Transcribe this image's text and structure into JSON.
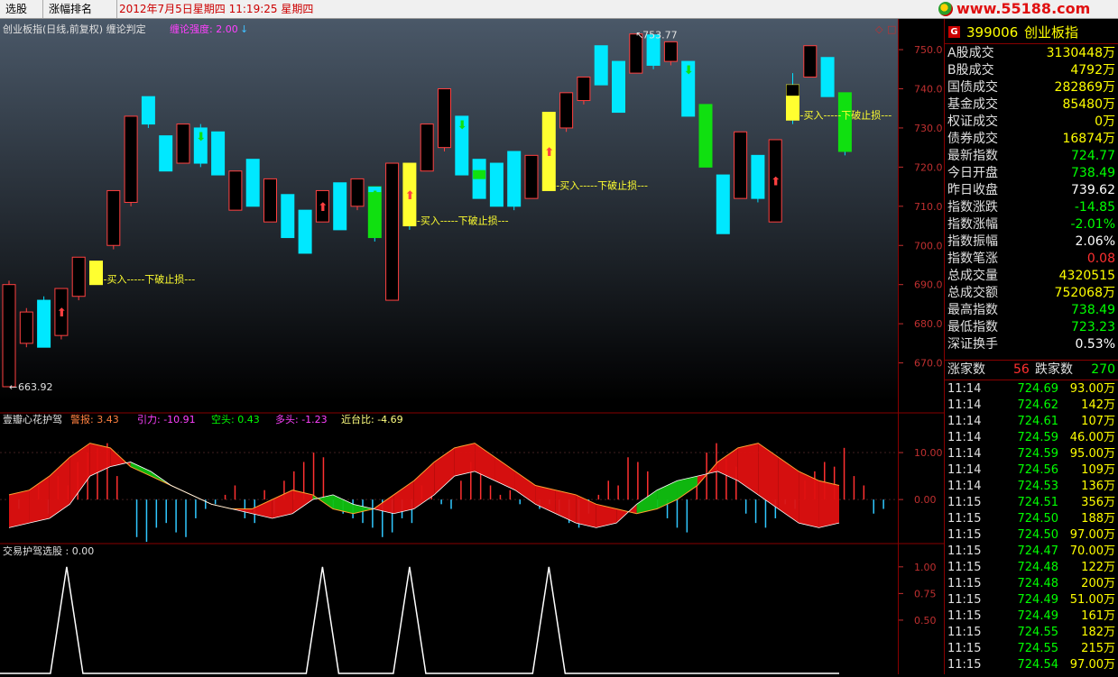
{
  "topbar": {
    "tabs": [
      "选股",
      "涨幅排名"
    ],
    "datetime": "2012年7月5日星期四  11:19:25 星期四",
    "logo": "www.55188.com"
  },
  "panels": {
    "main": {
      "title": "创业板指(日线,前复权) 缠论判定",
      "indicator": "缠论强度: 2.00",
      "high_label": "753.77",
      "low_label": "663.92",
      "buy_label": "--买入-----下破止损---",
      "y_ticks": [
        "750.0",
        "740.0",
        "730.0",
        "720.0",
        "710.0",
        "700.0",
        "690.0",
        "680.0",
        "670.0"
      ]
    },
    "middle": {
      "title": "壹瓣心花护驾",
      "warn": "警报: 3.43",
      "pull": "引力: -10.91",
      "short": "空头: 0.43",
      "long": "多头: -1.23",
      "near": "近台比: -4.69",
      "y_ticks": [
        "10.00",
        "0.00"
      ]
    },
    "bottom": {
      "title": "交易护驾选股 : 0.00",
      "y_ticks": [
        "1.00",
        "0.75",
        "0.50"
      ]
    }
  },
  "chart_data": {
    "type": "candlestick",
    "y_range": [
      660,
      756
    ],
    "candles": [
      {
        "o": 690,
        "c": 663.92,
        "h": 691,
        "l": 663.92,
        "style": "hollow"
      },
      {
        "o": 683,
        "c": 675,
        "h": 684,
        "l": 674,
        "style": "hollow"
      },
      {
        "o": 686,
        "c": 674,
        "h": 687,
        "l": 674,
        "style": "cyan"
      },
      {
        "o": 677,
        "c": 689,
        "h": 689,
        "l": 676,
        "style": "hollow",
        "mark": "up"
      },
      {
        "o": 687,
        "c": 697,
        "h": 697,
        "l": 686,
        "style": "hollow"
      },
      {
        "o": 690,
        "c": 696,
        "h": 696,
        "l": 690,
        "style": "yellow",
        "buy": true
      },
      {
        "o": 700,
        "c": 714,
        "h": 714,
        "l": 699,
        "style": "hollow"
      },
      {
        "o": 711,
        "c": 733,
        "h": 733,
        "l": 710,
        "style": "hollow"
      },
      {
        "o": 738,
        "c": 731,
        "h": 738,
        "l": 730,
        "style": "cyan"
      },
      {
        "o": 728,
        "c": 719,
        "h": 728,
        "l": 719,
        "style": "cyan"
      },
      {
        "o": 731,
        "c": 721,
        "h": 731,
        "l": 721,
        "style": "hollow"
      },
      {
        "o": 730,
        "c": 721,
        "h": 731,
        "l": 720,
        "style": "cyan",
        "mark": "down"
      },
      {
        "o": 729,
        "c": 718,
        "h": 729,
        "l": 718,
        "style": "cyan"
      },
      {
        "o": 719,
        "c": 709,
        "h": 719,
        "l": 709,
        "style": "hollow"
      },
      {
        "o": 722,
        "c": 710,
        "h": 722,
        "l": 710,
        "style": "cyan"
      },
      {
        "o": 717,
        "c": 706,
        "h": 717,
        "l": 706,
        "style": "hollow"
      },
      {
        "o": 713,
        "c": 702,
        "h": 713,
        "l": 702,
        "style": "cyan"
      },
      {
        "o": 709,
        "c": 698,
        "h": 709,
        "l": 698,
        "style": "cyan"
      },
      {
        "o": 706,
        "c": 714,
        "h": 714,
        "l": 706,
        "style": "hollow",
        "mark": "up"
      },
      {
        "o": 716,
        "c": 704,
        "h": 716,
        "l": 704,
        "style": "cyan"
      },
      {
        "o": 710,
        "c": 717,
        "h": 717,
        "l": 709,
        "style": "hollow"
      },
      {
        "o": 715,
        "c": 702,
        "h": 715,
        "l": 701,
        "style": "green",
        "cyantop": true,
        "mark": "down"
      },
      {
        "o": 686,
        "c": 721,
        "h": 721,
        "l": 686,
        "style": "hollow"
      },
      {
        "o": 705,
        "c": 721,
        "h": 721,
        "l": 704,
        "style": "yellow",
        "mark": "up",
        "buy": true
      },
      {
        "o": 719,
        "c": 731,
        "h": 731,
        "l": 719,
        "style": "hollow"
      },
      {
        "o": 740,
        "c": 725,
        "h": 740,
        "l": 724,
        "style": "hollow"
      },
      {
        "o": 733,
        "c": 718,
        "h": 733,
        "l": 718,
        "style": "cyan",
        "mark": "down"
      },
      {
        "o": 722,
        "c": 712,
        "h": 722,
        "l": 712,
        "style": "cyan",
        "greenmid": true
      },
      {
        "o": 721,
        "c": 710,
        "h": 721,
        "l": 710,
        "style": "cyan"
      },
      {
        "o": 724,
        "c": 710,
        "h": 724,
        "l": 709,
        "style": "cyan"
      },
      {
        "o": 723,
        "c": 712,
        "h": 723,
        "l": 712,
        "style": "hollow"
      },
      {
        "o": 714,
        "c": 734,
        "h": 734,
        "l": 714,
        "style": "yellow",
        "mark": "up",
        "buy": true
      },
      {
        "o": 730,
        "c": 739,
        "h": 739,
        "l": 729,
        "style": "hollow"
      },
      {
        "o": 743,
        "c": 737,
        "h": 743,
        "l": 736,
        "style": "hollow"
      },
      {
        "o": 751,
        "c": 741,
        "h": 751,
        "l": 741,
        "style": "cyan"
      },
      {
        "o": 747,
        "c": 734,
        "h": 747,
        "l": 734,
        "style": "cyan"
      },
      {
        "o": 744,
        "c": 754,
        "h": 754,
        "l": 744,
        "style": "hollow"
      },
      {
        "o": 753.77,
        "c": 746,
        "h": 753.77,
        "l": 745,
        "style": "cyan"
      },
      {
        "o": 747,
        "c": 752,
        "h": 752,
        "l": 746,
        "style": "hollow"
      },
      {
        "o": 747,
        "c": 733,
        "h": 747,
        "l": 733,
        "style": "cyan",
        "mark": "down"
      },
      {
        "o": 736,
        "c": 720,
        "h": 736,
        "l": 720,
        "style": "green"
      },
      {
        "o": 718,
        "c": 703,
        "h": 718,
        "l": 703,
        "style": "cyan"
      },
      {
        "o": 729,
        "c": 712,
        "h": 729,
        "l": 712,
        "style": "hollow"
      },
      {
        "o": 723,
        "c": 712,
        "h": 723,
        "l": 711,
        "style": "cyan"
      },
      {
        "o": 706,
        "c": 727,
        "h": 727,
        "l": 706,
        "style": "hollow",
        "mark": "up"
      },
      {
        "o": 732,
        "c": 741,
        "h": 744,
        "l": 731,
        "style": "yellow",
        "blacktop": true,
        "buy": true
      },
      {
        "o": 743,
        "c": 751,
        "h": 751,
        "l": 743,
        "style": "hollow"
      },
      {
        "o": 748,
        "c": 738,
        "h": 748,
        "l": 738,
        "style": "cyan"
      },
      {
        "o": 739,
        "c": 724,
        "h": 739,
        "l": 723,
        "style": "green",
        "mark": "down"
      }
    ],
    "oscillator_range": [
      -9,
      15
    ],
    "oscillator_bars": [
      0,
      -2,
      0,
      3,
      -3,
      5,
      3,
      8,
      10,
      11,
      12,
      5,
      0,
      -8,
      -9,
      -6,
      -5,
      -7,
      -8,
      -4,
      -2,
      -1,
      1,
      3,
      -4,
      -5,
      2,
      -3,
      4,
      6,
      8,
      10,
      9,
      -2,
      -3,
      -4,
      -5,
      -6,
      -8,
      -7,
      -4,
      -5,
      3,
      1,
      -1,
      -2,
      4,
      8,
      6,
      3,
      1,
      2,
      -1,
      0,
      -2,
      -1,
      -3,
      -5,
      -6,
      -3,
      1,
      4,
      3,
      9,
      8,
      6,
      -2,
      -4,
      -6,
      -7,
      5,
      10,
      12,
      9,
      7,
      -3,
      -5,
      -6,
      -4,
      -1,
      -2,
      4,
      6,
      8,
      7,
      11,
      5,
      3,
      -3,
      -2
    ],
    "osc_upper": [
      1,
      2,
      5,
      9,
      12,
      11,
      7,
      5,
      3,
      1,
      -1,
      -2,
      -2,
      0,
      2,
      1,
      -2,
      -3,
      -2,
      1,
      4,
      8,
      11,
      12,
      9,
      6,
      3,
      2,
      1,
      -1,
      -2,
      -3,
      -2,
      0,
      3,
      8,
      11,
      12,
      9,
      6,
      4,
      3
    ],
    "osc_lower": [
      -6,
      -5,
      -4,
      -1,
      5,
      7,
      8,
      6,
      3,
      1,
      -1,
      -2,
      -3,
      -4,
      -3,
      0,
      1,
      -1,
      -2,
      -3,
      -2,
      1,
      5,
      6,
      4,
      2,
      -1,
      -3,
      -5,
      -6,
      -5,
      -1,
      2,
      4,
      5,
      6,
      4,
      1,
      -2,
      -5,
      -6,
      -5
    ],
    "signal_x_idx": [
      3,
      18,
      23,
      31
    ],
    "bottom_range": [
      0,
      1.1
    ]
  },
  "quote": {
    "code": "399006",
    "name": "创业板指",
    "rows": [
      {
        "label": "A股成交",
        "value": "3130448万",
        "color": "#ffff00"
      },
      {
        "label": "B股成交",
        "value": "4792万",
        "color": "#ffff00"
      },
      {
        "label": "国债成交",
        "value": "282869万",
        "color": "#ffff00"
      },
      {
        "label": "基金成交",
        "value": "85480万",
        "color": "#ffff00"
      },
      {
        "label": "权证成交",
        "value": "0万",
        "color": "#ffff00"
      },
      {
        "label": "债券成交",
        "value": "16874万",
        "color": "#ffff00"
      },
      {
        "label": "最新指数",
        "value": "724.77",
        "color": "#00ff00"
      },
      {
        "label": "今日开盘",
        "value": "738.49",
        "color": "#00ff00"
      },
      {
        "label": "昨日收盘",
        "value": "739.62",
        "color": "#ffffff"
      },
      {
        "label": "指数涨跌",
        "value": "-14.85",
        "color": "#00ff00"
      },
      {
        "label": "指数涨幅",
        "value": "-2.01%",
        "color": "#00ff00"
      },
      {
        "label": "指数振幅",
        "value": "2.06%",
        "color": "#ffffff"
      },
      {
        "label": "指数笔涨",
        "value": "0.08",
        "color": "#ff3030"
      },
      {
        "label": "总成交量",
        "value": "4320515",
        "color": "#ffff00"
      },
      {
        "label": "总成交额",
        "value": "752068万",
        "color": "#ffff00"
      },
      {
        "label": "最高指数",
        "value": "738.49",
        "color": "#00ff00"
      },
      {
        "label": "最低指数",
        "value": "723.23",
        "color": "#00ff00"
      },
      {
        "label": "深证换手",
        "value": "0.53%",
        "color": "#ffffff"
      }
    ],
    "breadth": {
      "up_label": "涨家数",
      "up": "56",
      "down_label": "跌家数",
      "down": "270"
    },
    "ticks": [
      {
        "t": "11:14",
        "p": "724.69",
        "v": "93.00万"
      },
      {
        "t": "11:14",
        "p": "724.62",
        "v": "142万"
      },
      {
        "t": "11:14",
        "p": "724.61",
        "v": "107万"
      },
      {
        "t": "11:14",
        "p": "724.59",
        "v": "46.00万"
      },
      {
        "t": "11:14",
        "p": "724.59",
        "v": "95.00万"
      },
      {
        "t": "11:14",
        "p": "724.56",
        "v": "109万"
      },
      {
        "t": "11:14",
        "p": "724.53",
        "v": "136万"
      },
      {
        "t": "11:15",
        "p": "724.51",
        "v": "356万"
      },
      {
        "t": "11:15",
        "p": "724.50",
        "v": "188万"
      },
      {
        "t": "11:15",
        "p": "724.50",
        "v": "97.00万"
      },
      {
        "t": "11:15",
        "p": "724.47",
        "v": "70.00万"
      },
      {
        "t": "11:15",
        "p": "724.48",
        "v": "122万"
      },
      {
        "t": "11:15",
        "p": "724.48",
        "v": "200万"
      },
      {
        "t": "11:15",
        "p": "724.49",
        "v": "51.00万"
      },
      {
        "t": "11:15",
        "p": "724.49",
        "v": "161万"
      },
      {
        "t": "11:15",
        "p": "724.55",
        "v": "182万"
      },
      {
        "t": "11:15",
        "p": "724.55",
        "v": "215万"
      },
      {
        "t": "11:15",
        "p": "724.54",
        "v": "97.00万"
      }
    ]
  }
}
